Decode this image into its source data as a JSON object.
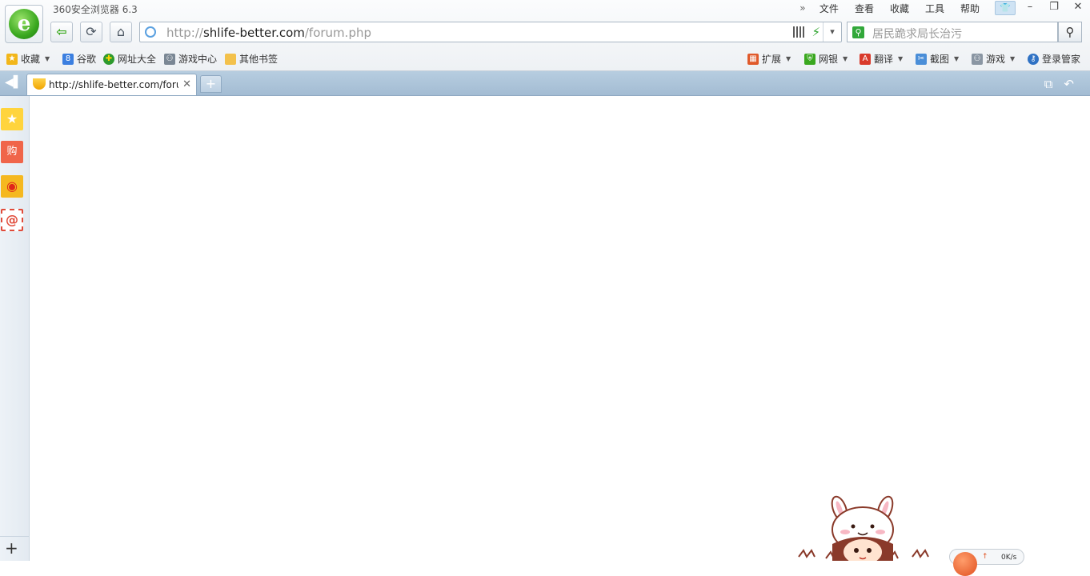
{
  "window": {
    "title": "360安全浏览器 6.3",
    "menu": [
      "文件",
      "查看",
      "收藏",
      "工具",
      "帮助"
    ]
  },
  "nav": {
    "url_prefix": "http://",
    "url_domain": "shlife-better.com",
    "url_path": "/forum.php",
    "search_placeholder": "居民跪求局长治污"
  },
  "bookmarks": {
    "left": [
      {
        "label": "收藏",
        "icon": "star-plus-icon",
        "has_dropdown": true
      },
      {
        "label": "谷歌",
        "icon": "google-icon"
      },
      {
        "label": "网址大全",
        "icon": "site-directory-icon"
      },
      {
        "label": "游戏中心",
        "icon": "gamepad-icon"
      },
      {
        "label": "其他书签",
        "icon": "folder-icon"
      }
    ],
    "right": [
      {
        "label": "扩展",
        "icon": "extensions-icon",
        "has_dropdown": true
      },
      {
        "label": "网银",
        "icon": "shield-icon",
        "has_dropdown": true
      },
      {
        "label": "翻译",
        "icon": "translate-icon",
        "has_dropdown": true
      },
      {
        "label": "截图",
        "icon": "screenshot-icon",
        "has_dropdown": true
      },
      {
        "label": "游戏",
        "icon": "game-controller-icon",
        "has_dropdown": true
      },
      {
        "label": "登录管家",
        "icon": "key-icon"
      }
    ]
  },
  "tabs": [
    {
      "title": "http://shlife-better.com/forum.php",
      "active": true
    }
  ],
  "status": {
    "speed": "0K/s"
  },
  "colors": {
    "tabstrip": "#a3bcd3",
    "accent_green": "#3aa81f",
    "search_green": "#32a83a"
  }
}
